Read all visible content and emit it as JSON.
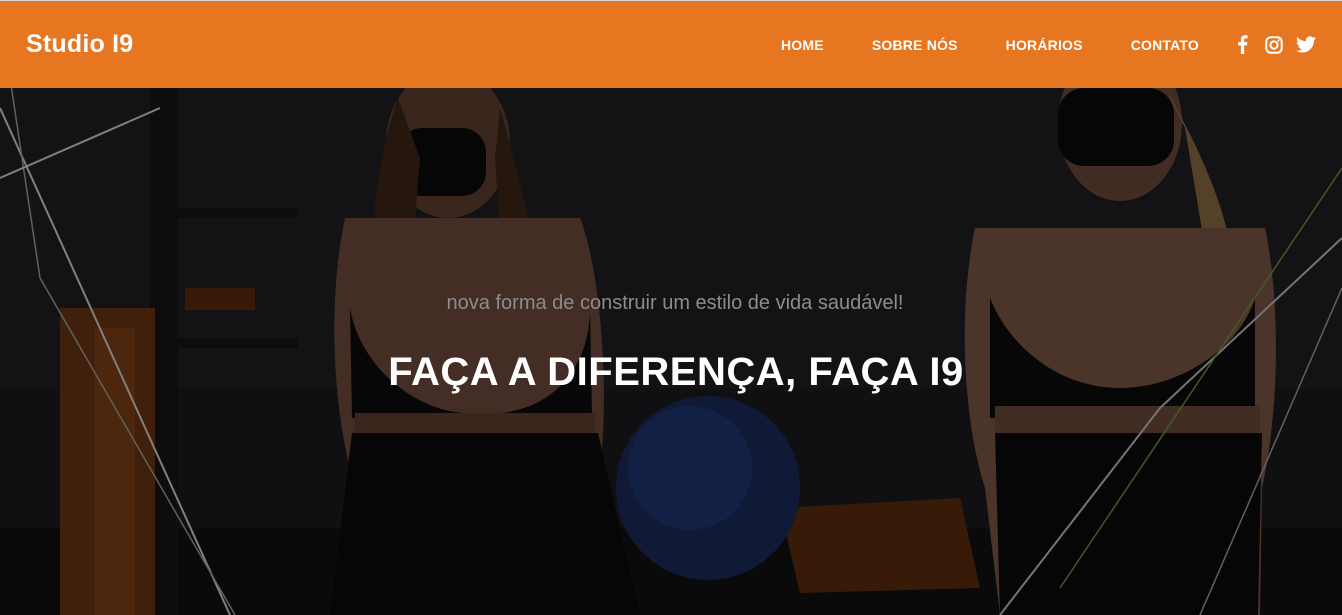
{
  "brand": {
    "name": "Studio I9"
  },
  "nav": {
    "items": [
      {
        "label": "HOME"
      },
      {
        "label": "SOBRE NÓS"
      },
      {
        "label": "HORÁRIOS"
      },
      {
        "label": "CONTATO"
      }
    ]
  },
  "social": {
    "icons": [
      "facebook-icon",
      "instagram-icon",
      "twitter-icon"
    ]
  },
  "hero": {
    "subtitle": "nova forma de construir um estilo de vida saudável!",
    "headline": "FAÇA A DIFERENÇA, FAÇA I9"
  },
  "colors": {
    "navbar": "#e67620",
    "text_light": "#ffffff",
    "subtitle": "#8c8c8c"
  }
}
